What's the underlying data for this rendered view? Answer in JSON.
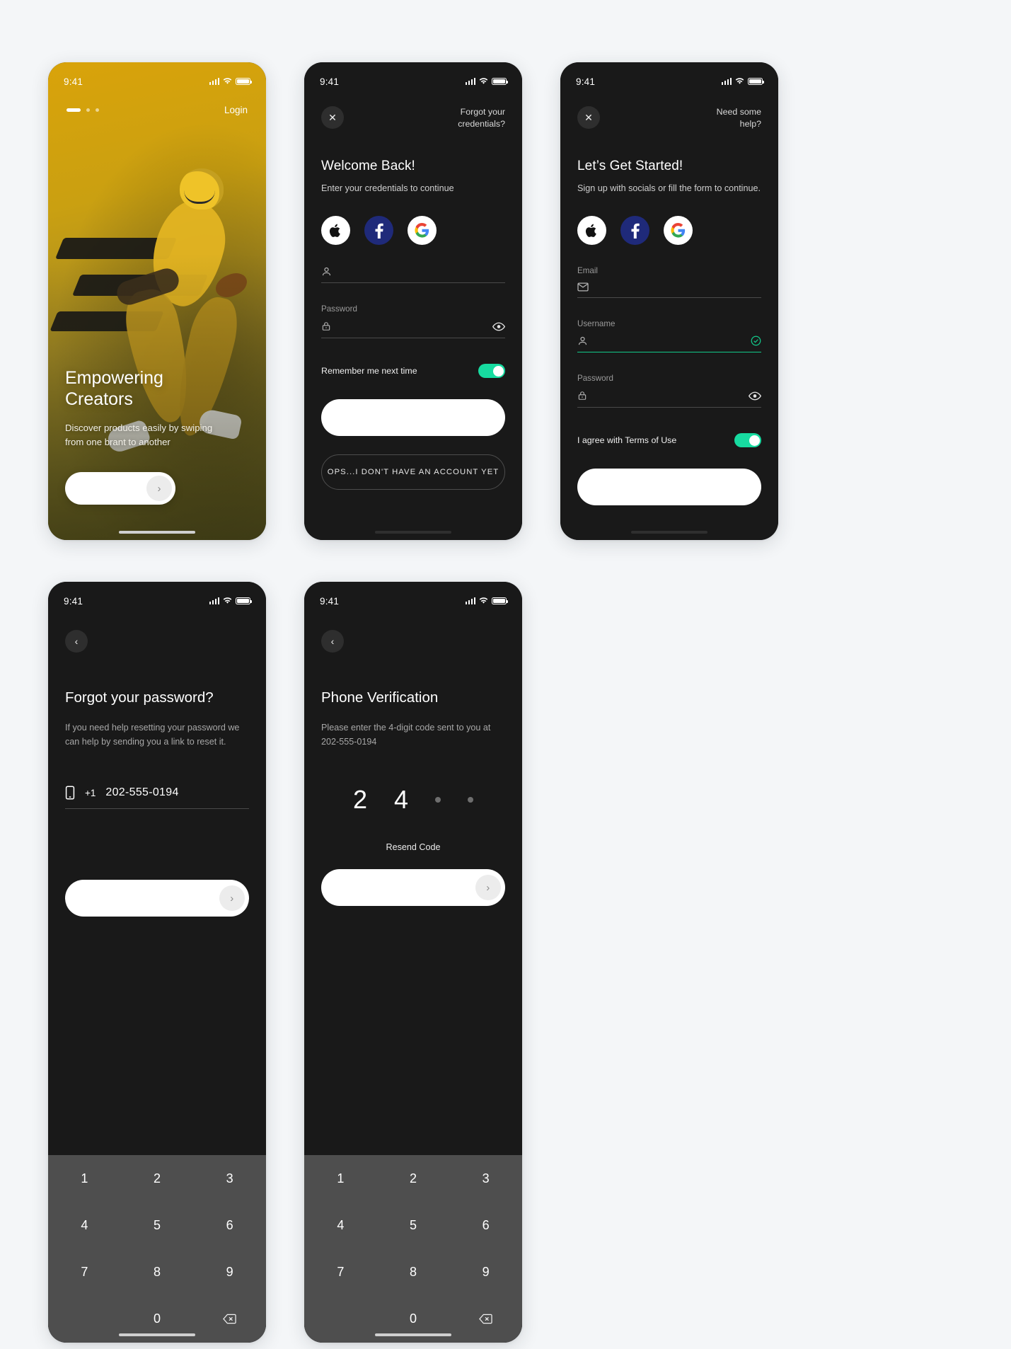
{
  "status_bar": {
    "time": "9:41"
  },
  "screens": {
    "onboarding": {
      "login_link": "Login",
      "title_line1": "Empowering",
      "title_line2": "Creators",
      "description": "Discover products easily by swiping from one brant to another",
      "cta_icon": "chevron-right-icon",
      "pagination": {
        "active_index": 0,
        "count": 3
      }
    },
    "signin": {
      "close_icon": "close-icon",
      "top_link": "Forgot your credentials?",
      "title": "Welcome Back!",
      "subtitle": "Enter your credentials to continue",
      "socials": [
        {
          "name": "apple",
          "glyph": ""
        },
        {
          "name": "facebook",
          "glyph": "f"
        },
        {
          "name": "google",
          "glyph": "G"
        }
      ],
      "username_field": {
        "label": "",
        "value": "",
        "icon": "user-icon"
      },
      "password_field": {
        "label": "Password",
        "value": "",
        "icon": "lock-icon",
        "trailing_icon": "eye-icon"
      },
      "remember_label": "Remember me next time",
      "remember_on": true,
      "primary_button": "",
      "secondary_button": "OPS...I DON'T HAVE AN ACCOUNT YET"
    },
    "signup": {
      "close_icon": "close-icon",
      "top_link": "Need some help?",
      "title": "Let’s Get Started!",
      "subtitle": "Sign up  with socials or fill the form to continue.",
      "socials": [
        {
          "name": "apple",
          "glyph": ""
        },
        {
          "name": "facebook",
          "glyph": "f"
        },
        {
          "name": "google",
          "glyph": "G"
        }
      ],
      "email_field": {
        "label": "Email",
        "value": "",
        "icon": "mail-icon"
      },
      "username_field": {
        "label": "Username",
        "value": "",
        "icon": "user-icon",
        "trailing_icon": "check-circle-icon",
        "valid": true
      },
      "password_field": {
        "label": "Password",
        "value": "",
        "icon": "lock-icon",
        "trailing_icon": "eye-icon"
      },
      "terms_label": "I agree with Terms of Use",
      "terms_on": true,
      "primary_button": ""
    },
    "forgot_password": {
      "back_icon": "chevron-left-icon",
      "title": "Forgot your password?",
      "description": "If you need help resetting your password we can help by sending you a link to reset it.",
      "phone_icon": "phone-icon",
      "country_code": "+1",
      "phone_number": "202-555-0194",
      "cta_icon": "chevron-right-icon"
    },
    "phone_verification": {
      "back_icon": "chevron-left-icon",
      "title": "Phone Verification",
      "description": "Please enter the 4-digit code sent to you at 202-555-0194",
      "code_entered": [
        "2",
        "4"
      ],
      "code_length": 4,
      "resend_label": "Resend Code",
      "cta_icon": "chevron-right-icon"
    }
  },
  "keypad": {
    "keys": [
      "1",
      "2",
      "3",
      "4",
      "5",
      "6",
      "7",
      "8",
      "9",
      "",
      "0",
      "⌫"
    ]
  },
  "colors": {
    "accent_green": "#17dba0",
    "brand_yellow": "#d9a30a",
    "facebook_blue": "#1f2a7a",
    "dark_bg": "#191919",
    "keypad_bg": "#4e4e4e",
    "page_bg": "#f4f6f8"
  }
}
